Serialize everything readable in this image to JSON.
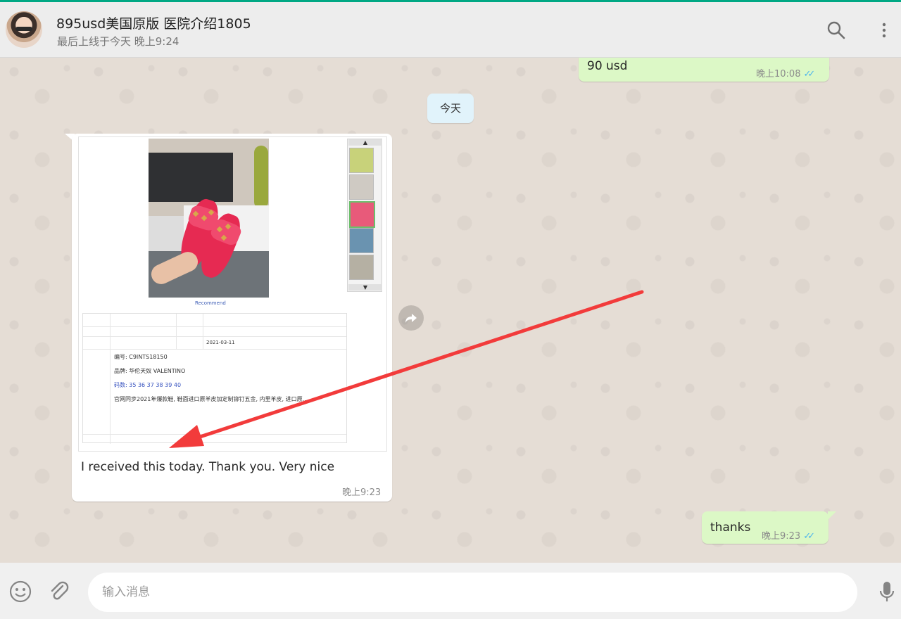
{
  "header": {
    "contact_name": "895usd美国原版 医院介绍1805",
    "contact_status": "最后上线于今天 晚上9:24",
    "icons": [
      "search-icon",
      "menu-dots-icon"
    ]
  },
  "chat": {
    "date_divider": "今天",
    "messages": [
      {
        "direction": "out",
        "text": "90 usd",
        "time": "晚上10:08",
        "ticks": "✓✓"
      },
      {
        "direction": "in",
        "text": "I received this today. Thank you. Very nice",
        "time": "晚上9:23"
      },
      {
        "direction": "out",
        "text": "thanks",
        "time": "晚上9:23",
        "ticks": "✓✓"
      }
    ],
    "image_content": {
      "caption_link": "Recommend",
      "spec_lines": [
        "编号: C9INTS18150",
        "品牌: 华伦天奴 VALENTINO",
        "码数: 35 36 37 38 39 40",
        "官网同步2021年爆款鞋, 鞋面进口原羊皮加定制铆钉五金, 内里羊皮, 进口原..."
      ],
      "spec_date": "2021-03-11"
    },
    "arrow_color": "#f23b3b"
  },
  "composer": {
    "placeholder": "输入消息",
    "icons": [
      "emoji-icon",
      "attach-icon",
      "microphone-icon"
    ]
  },
  "colors": {
    "accent": "#00a884",
    "outgoing_bubble": "#dcf8c6",
    "incoming_bubble": "#ffffff",
    "date_chip": "#e1f3fb",
    "read_ticks": "#4fb6ec"
  }
}
